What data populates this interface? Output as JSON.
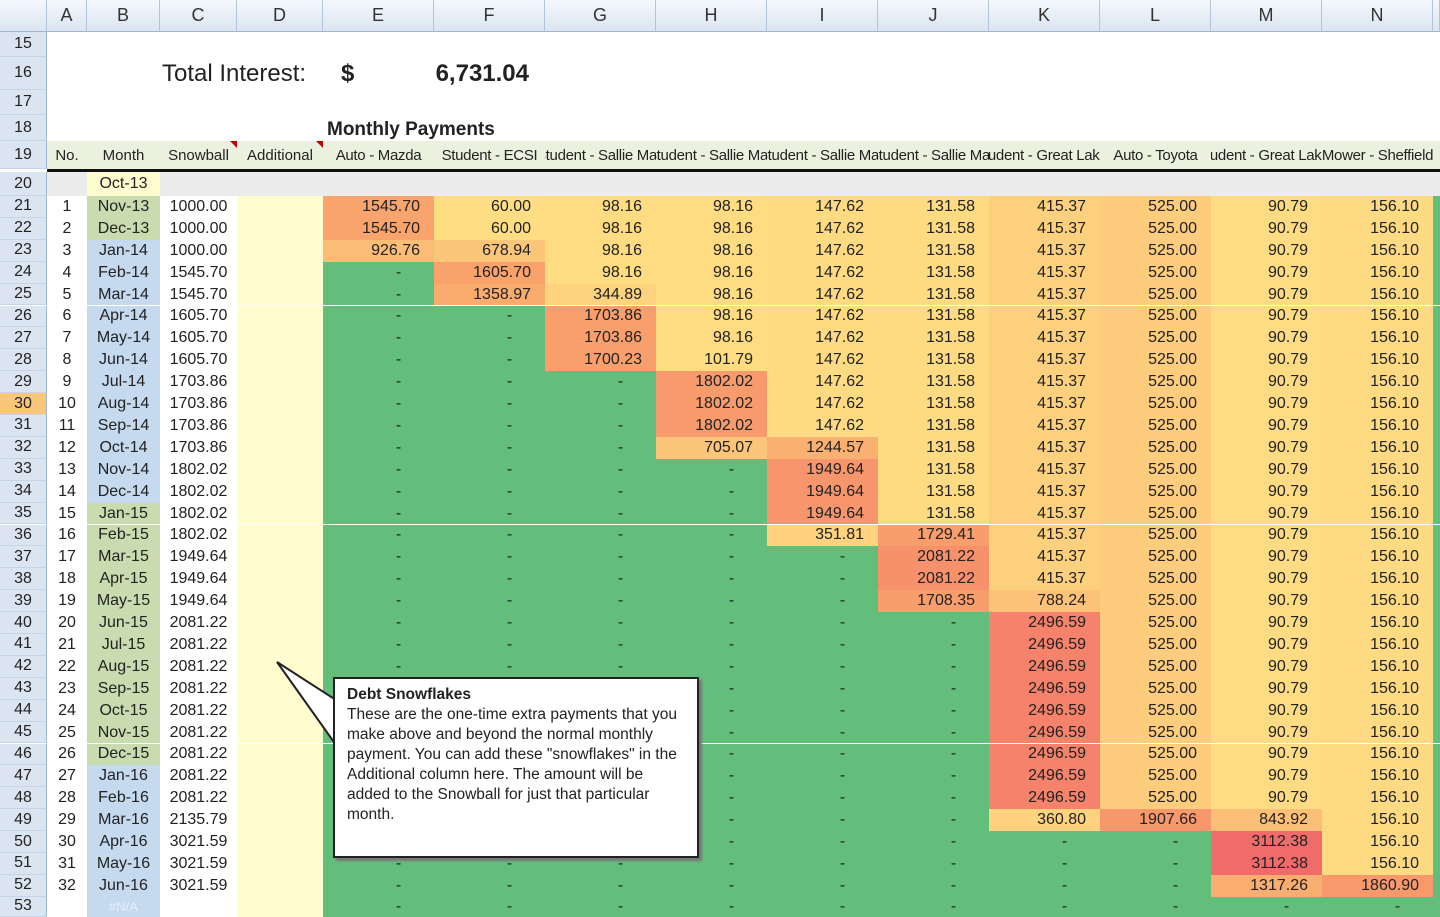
{
  "columns": [
    "A",
    "B",
    "C",
    "D",
    "E",
    "F",
    "G",
    "H",
    "I",
    "J",
    "K",
    "L",
    "M",
    "N"
  ],
  "summary": {
    "label": "Total Interest:",
    "currency": "$",
    "value": "6,731.04"
  },
  "section_title": "Monthly Payments",
  "headers": {
    "no": "No.",
    "month": "Month",
    "snowball": "Snowball",
    "additional": "Additional",
    "debts": [
      "Auto - Mazda",
      "Student - ECSI",
      "Student - Sallie Mae",
      "Student - Sallie Mae",
      "Student - Sallie Mae",
      "Student - Sallie Mae",
      "Student - Great Lakes",
      "Auto - Toyota",
      "Student - Great Lakes",
      "Mower - Sheffield"
    ]
  },
  "start_month": "Oct-13",
  "active_row": 30,
  "colors": {
    "paid_off": "#63be7b",
    "low": "#ffe084",
    "mid": "#f9a46c",
    "high": "#f26b6b",
    "max_value": 3112.38
  },
  "rows": [
    {
      "n": 21,
      "no": "1",
      "month": "Nov-13",
      "snowball": "1000.00",
      "p": [
        "1545.70",
        "60.00",
        "98.16",
        "98.16",
        "147.62",
        "131.58",
        "415.37",
        "525.00",
        "90.79",
        "156.10"
      ]
    },
    {
      "n": 22,
      "no": "2",
      "month": "Dec-13",
      "snowball": "1000.00",
      "p": [
        "1545.70",
        "60.00",
        "98.16",
        "98.16",
        "147.62",
        "131.58",
        "415.37",
        "525.00",
        "90.79",
        "156.10"
      ]
    },
    {
      "n": 23,
      "no": "3",
      "month": "Jan-14",
      "snowball": "1000.00",
      "p": [
        "926.76",
        "678.94",
        "98.16",
        "98.16",
        "147.62",
        "131.58",
        "415.37",
        "525.00",
        "90.79",
        "156.10"
      ]
    },
    {
      "n": 24,
      "no": "4",
      "month": "Feb-14",
      "snowball": "1545.70",
      "p": [
        "-",
        "1605.70",
        "98.16",
        "98.16",
        "147.62",
        "131.58",
        "415.37",
        "525.00",
        "90.79",
        "156.10"
      ]
    },
    {
      "n": 25,
      "no": "5",
      "month": "Mar-14",
      "snowball": "1545.70",
      "p": [
        "-",
        "1358.97",
        "344.89",
        "98.16",
        "147.62",
        "131.58",
        "415.37",
        "525.00",
        "90.79",
        "156.10"
      ]
    },
    {
      "n": 26,
      "no": "6",
      "month": "Apr-14",
      "snowball": "1605.70",
      "p": [
        "-",
        "-",
        "1703.86",
        "98.16",
        "147.62",
        "131.58",
        "415.37",
        "525.00",
        "90.79",
        "156.10"
      ]
    },
    {
      "n": 27,
      "no": "7",
      "month": "May-14",
      "snowball": "1605.70",
      "p": [
        "-",
        "-",
        "1703.86",
        "98.16",
        "147.62",
        "131.58",
        "415.37",
        "525.00",
        "90.79",
        "156.10"
      ]
    },
    {
      "n": 28,
      "no": "8",
      "month": "Jun-14",
      "snowball": "1605.70",
      "p": [
        "-",
        "-",
        "1700.23",
        "101.79",
        "147.62",
        "131.58",
        "415.37",
        "525.00",
        "90.79",
        "156.10"
      ]
    },
    {
      "n": 29,
      "no": "9",
      "month": "Jul-14",
      "snowball": "1703.86",
      "p": [
        "-",
        "-",
        "-",
        "1802.02",
        "147.62",
        "131.58",
        "415.37",
        "525.00",
        "90.79",
        "156.10"
      ]
    },
    {
      "n": 30,
      "no": "10",
      "month": "Aug-14",
      "snowball": "1703.86",
      "p": [
        "-",
        "-",
        "-",
        "1802.02",
        "147.62",
        "131.58",
        "415.37",
        "525.00",
        "90.79",
        "156.10"
      ]
    },
    {
      "n": 31,
      "no": "11",
      "month": "Sep-14",
      "snowball": "1703.86",
      "p": [
        "-",
        "-",
        "-",
        "1802.02",
        "147.62",
        "131.58",
        "415.37",
        "525.00",
        "90.79",
        "156.10"
      ]
    },
    {
      "n": 32,
      "no": "12",
      "month": "Oct-14",
      "snowball": "1703.86",
      "p": [
        "-",
        "-",
        "-",
        "705.07",
        "1244.57",
        "131.58",
        "415.37",
        "525.00",
        "90.79",
        "156.10"
      ]
    },
    {
      "n": 33,
      "no": "13",
      "month": "Nov-14",
      "snowball": "1802.02",
      "p": [
        "-",
        "-",
        "-",
        "-",
        "1949.64",
        "131.58",
        "415.37",
        "525.00",
        "90.79",
        "156.10"
      ]
    },
    {
      "n": 34,
      "no": "14",
      "month": "Dec-14",
      "snowball": "1802.02",
      "p": [
        "-",
        "-",
        "-",
        "-",
        "1949.64",
        "131.58",
        "415.37",
        "525.00",
        "90.79",
        "156.10"
      ]
    },
    {
      "n": 35,
      "no": "15",
      "month": "Jan-15",
      "snowball": "1802.02",
      "p": [
        "-",
        "-",
        "-",
        "-",
        "1949.64",
        "131.58",
        "415.37",
        "525.00",
        "90.79",
        "156.10"
      ]
    },
    {
      "n": 36,
      "no": "16",
      "month": "Feb-15",
      "snowball": "1802.02",
      "p": [
        "-",
        "-",
        "-",
        "-",
        "351.81",
        "1729.41",
        "415.37",
        "525.00",
        "90.79",
        "156.10"
      ]
    },
    {
      "n": 37,
      "no": "17",
      "month": "Mar-15",
      "snowball": "1949.64",
      "p": [
        "-",
        "-",
        "-",
        "-",
        "-",
        "2081.22",
        "415.37",
        "525.00",
        "90.79",
        "156.10"
      ]
    },
    {
      "n": 38,
      "no": "18",
      "month": "Apr-15",
      "snowball": "1949.64",
      "p": [
        "-",
        "-",
        "-",
        "-",
        "-",
        "2081.22",
        "415.37",
        "525.00",
        "90.79",
        "156.10"
      ]
    },
    {
      "n": 39,
      "no": "19",
      "month": "May-15",
      "snowball": "1949.64",
      "p": [
        "-",
        "-",
        "-",
        "-",
        "-",
        "1708.35",
        "788.24",
        "525.00",
        "90.79",
        "156.10"
      ]
    },
    {
      "n": 40,
      "no": "20",
      "month": "Jun-15",
      "snowball": "2081.22",
      "p": [
        "-",
        "-",
        "-",
        "-",
        "-",
        "-",
        "2496.59",
        "525.00",
        "90.79",
        "156.10"
      ]
    },
    {
      "n": 41,
      "no": "21",
      "month": "Jul-15",
      "snowball": "2081.22",
      "p": [
        "-",
        "-",
        "-",
        "-",
        "-",
        "-",
        "2496.59",
        "525.00",
        "90.79",
        "156.10"
      ]
    },
    {
      "n": 42,
      "no": "22",
      "month": "Aug-15",
      "snowball": "2081.22",
      "p": [
        "-",
        "-",
        "-",
        "-",
        "-",
        "-",
        "2496.59",
        "525.00",
        "90.79",
        "156.10"
      ]
    },
    {
      "n": 43,
      "no": "23",
      "month": "Sep-15",
      "snowball": "2081.22",
      "p": [
        "-",
        "-",
        "-",
        "-",
        "-",
        "-",
        "2496.59",
        "525.00",
        "90.79",
        "156.10"
      ]
    },
    {
      "n": 44,
      "no": "24",
      "month": "Oct-15",
      "snowball": "2081.22",
      "p": [
        "-",
        "-",
        "-",
        "-",
        "-",
        "-",
        "2496.59",
        "525.00",
        "90.79",
        "156.10"
      ]
    },
    {
      "n": 45,
      "no": "25",
      "month": "Nov-15",
      "snowball": "2081.22",
      "p": [
        "-",
        "-",
        "-",
        "-",
        "-",
        "-",
        "2496.59",
        "525.00",
        "90.79",
        "156.10"
      ]
    },
    {
      "n": 46,
      "no": "26",
      "month": "Dec-15",
      "snowball": "2081.22",
      "p": [
        "-",
        "-",
        "-",
        "-",
        "-",
        "-",
        "2496.59",
        "525.00",
        "90.79",
        "156.10"
      ]
    },
    {
      "n": 47,
      "no": "27",
      "month": "Jan-16",
      "snowball": "2081.22",
      "p": [
        "-",
        "-",
        "-",
        "-",
        "-",
        "-",
        "2496.59",
        "525.00",
        "90.79",
        "156.10"
      ]
    },
    {
      "n": 48,
      "no": "28",
      "month": "Feb-16",
      "snowball": "2081.22",
      "p": [
        "-",
        "-",
        "-",
        "-",
        "-",
        "-",
        "2496.59",
        "525.00",
        "90.79",
        "156.10"
      ]
    },
    {
      "n": 49,
      "no": "29",
      "month": "Mar-16",
      "snowball": "2135.79",
      "p": [
        "-",
        "-",
        "-",
        "-",
        "-",
        "-",
        "360.80",
        "1907.66",
        "843.92",
        "156.10"
      ]
    },
    {
      "n": 50,
      "no": "30",
      "month": "Apr-16",
      "snowball": "3021.59",
      "p": [
        "-",
        "-",
        "-",
        "-",
        "-",
        "-",
        "-",
        "-",
        "3112.38",
        "156.10"
      ]
    },
    {
      "n": 51,
      "no": "31",
      "month": "May-16",
      "snowball": "3021.59",
      "p": [
        "-",
        "-",
        "-",
        "-",
        "-",
        "-",
        "-",
        "-",
        "3112.38",
        "156.10"
      ]
    },
    {
      "n": 52,
      "no": "32",
      "month": "Jun-16",
      "snowball": "3021.59",
      "p": [
        "-",
        "-",
        "-",
        "-",
        "-",
        "-",
        "-",
        "-",
        "1317.26",
        "1860.90"
      ]
    },
    {
      "n": 53,
      "no": "",
      "month": "#N/A",
      "snowball": "",
      "p": [
        "-",
        "-",
        "-",
        "-",
        "-",
        "-",
        "-",
        "-",
        "-",
        "-"
      ]
    }
  ],
  "comment": {
    "title": "Debt Snowflakes",
    "body": "These are the one-time extra payments that you make above and beyond the normal monthly payment. You can add these \"snowflakes\" in the Additional column here. The amount will be added to the Snowball for just that particular month."
  }
}
